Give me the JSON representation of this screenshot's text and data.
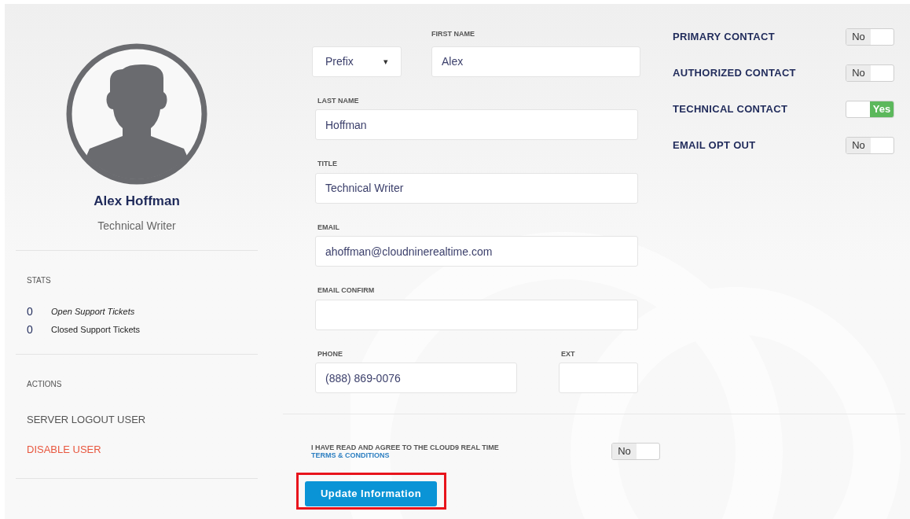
{
  "profile": {
    "name": "Alex Hoffman",
    "title": "Technical Writer"
  },
  "stats": {
    "heading": "STATS",
    "items": [
      {
        "count": "0",
        "label": "Open Support Tickets",
        "italic": true
      },
      {
        "count": "0",
        "label": "Closed Support Tickets",
        "italic": false
      }
    ]
  },
  "actions": {
    "heading": "ACTIONS",
    "items": [
      {
        "label": "SERVER LOGOUT USER",
        "kind": "normal"
      },
      {
        "label": "DISABLE USER",
        "kind": "danger"
      }
    ]
  },
  "form": {
    "prefix": {
      "value": "Prefix",
      "caret": "▾"
    },
    "first_name": {
      "label": "FIRST NAME",
      "value": "Alex"
    },
    "fields": [
      {
        "label": "LAST NAME",
        "value": "Hoffman"
      },
      {
        "label": "TITLE",
        "value": "Technical Writer"
      },
      {
        "label": "EMAIL",
        "value": "ahoffman@cloudninerealtime.com"
      },
      {
        "label": "EMAIL CONFIRM"
      }
    ],
    "phone": {
      "label": "PHONE",
      "value": "(888) 869-0076"
    },
    "ext": {
      "label": "EXT"
    }
  },
  "terms": {
    "text": "I HAVE READ AND AGREE TO THE CLOUD9 REAL TIME",
    "link": "TERMS & CONDITIONS",
    "toggle": {
      "on": false,
      "label": "No"
    }
  },
  "submit": {
    "label": "Update Information",
    "highlighted": true
  },
  "contact_flags": [
    {
      "label": "PRIMARY CONTACT",
      "on": false,
      "toggle_label": "No"
    },
    {
      "label": "AUTHORIZED CONTACT",
      "on": false,
      "toggle_label": "No"
    },
    {
      "label": "TECHNICAL CONTACT",
      "on": true,
      "toggle_label": "Yes"
    },
    {
      "label": "EMAIL OPT OUT",
      "on": false,
      "toggle_label": "No"
    }
  ]
}
